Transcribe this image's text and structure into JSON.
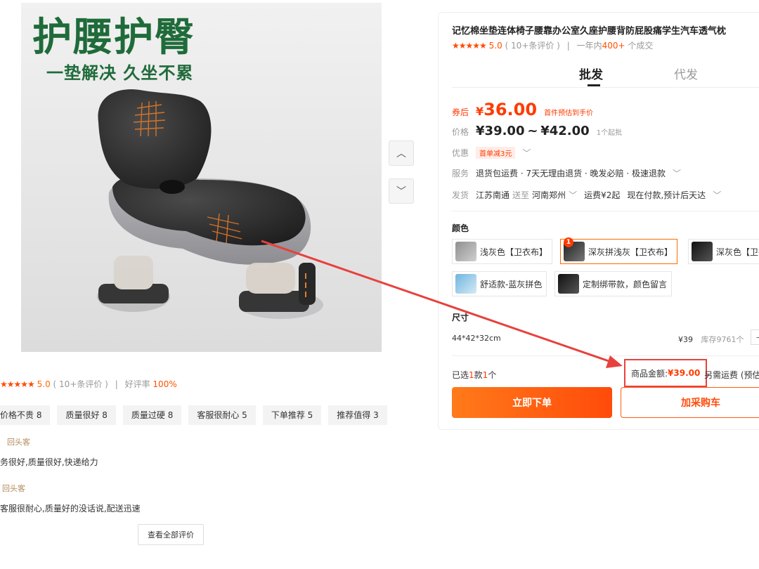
{
  "hero": {
    "title": "护腰护臀",
    "subtitle": "一垫解决 久坐不累"
  },
  "gallery": {
    "prev_icon": "chevron-up-icon",
    "next_icon": "chevron-down-icon",
    "prev_glyph": "︿",
    "next_glyph": "﹀"
  },
  "reviews_summary": {
    "stars": "★★★★★",
    "score": "5.0",
    "count_text": "( 10+条评价 )",
    "sep": "|",
    "good_rate_label": "好评率",
    "good_rate_value": "100%",
    "tags": [
      "价格不贵 8",
      "质量很好 8",
      "质量过硬 8",
      "客服很耐心 5",
      "下单推荐 5",
      "推荐值得 3"
    ],
    "reviews": [
      {
        "who": "回头客",
        "text": "务很好,质量很好,快递给力"
      },
      {
        "who": "回头客",
        "text": "客服很耐心,质量好的没话说,配送迅速"
      }
    ],
    "see_all": "查看全部评价"
  },
  "product": {
    "title": "记忆棉坐垫连体椅子腰靠办公室久座护腰背防屁股痛学生汽车透气枕",
    "stars": "★★★★★",
    "score": "5.0",
    "count_text": "( 10+条评价 )",
    "sep": "|",
    "sold_prefix": "一年内",
    "sold_num": "400+",
    "sold_suffix": "个成交",
    "tabs": [
      "批发",
      "代发"
    ],
    "coupon_label": "券后",
    "coupon_yen": "¥",
    "coupon_price": "36.00",
    "coupon_note": "首件预估到手价",
    "price_label": "价格",
    "price_range_low": "¥39.00",
    "price_tilde": "~",
    "price_range_high": "¥42.00",
    "price_moq": "1个起批",
    "promo_label": "优惠",
    "promo_badge": "首单减3元",
    "service_label": "服务",
    "service_items": "退货包运费 · 7天无理由退货 · 晚发必赔 · 极速退款",
    "ship_label": "发货",
    "ship_from": "江苏南通",
    "ship_to_word": "送至",
    "ship_to": "河南郑州",
    "ship_fee": "运费¥2起",
    "ship_eta": "现在付款,预计后天达",
    "color_label": "颜色",
    "skus": [
      {
        "label": "浅灰色【卫衣布】",
        "thumb": "light"
      },
      {
        "label": "深灰拼浅灰【卫衣布】",
        "thumb": "dark",
        "badge": "1"
      },
      {
        "label": "深灰色【卫衣布】",
        "thumb": "black"
      },
      {
        "label": "舒适款-蓝灰拼色",
        "thumb": "blue"
      },
      {
        "label": "定制绑带款，颜色留言",
        "thumb": "black"
      }
    ],
    "size_label": "尺寸",
    "size_value": "44*42*32cm",
    "size_price": "¥39",
    "size_stock": "库存9761个",
    "selected_prefix": "已选",
    "selected_kinds": "1",
    "selected_mid": "款",
    "selected_count": "1",
    "selected_suffix": "个",
    "amount_label": "商品金额:",
    "amount_value": "¥39.00",
    "shipping_note": "另需运费 (预估)",
    "buy_label": "立即下单",
    "cart_label": "加采购车"
  },
  "colors": {
    "accent": "#ff4b0a",
    "brand_green": "#1f6b3a",
    "highlight_red": "#e8413d"
  }
}
